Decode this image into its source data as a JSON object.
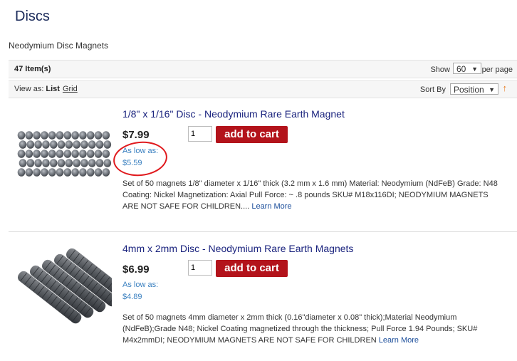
{
  "page": {
    "title": "Discs",
    "subtitle": "Neodymium Disc Magnets"
  },
  "toolbar": {
    "count": "47 Item(s)",
    "show_label": "Show",
    "show_value": "60",
    "per_page_label": "per page",
    "view_as_label": "View as:",
    "view_list": "List",
    "view_grid": "Grid",
    "sort_by_label": "Sort By",
    "sort_value": "Position",
    "sort_dir_icon": "↑"
  },
  "products": [
    {
      "name": "1/8\" x 1/16\" Disc - Neodymium Rare Earth Magnet",
      "price": "$7.99",
      "qty": "1",
      "cart_label": "add to cart",
      "as_low_as_label": "As low as:",
      "as_low_as_price": "$5.59",
      "description": "Set of 50 magnets 1/8\" diameter x 1/16\" thick (3.2 mm x 1.6 mm) Material: Neodymium (NdFeB) Grade: N48 Coating: Nickel Magnetization: Axial Pull Force: ~ .8 pounds SKU# M18x116DI; NEODYMIUM MAGNETS ARE NOT SAFE FOR CHILDREN.... ",
      "learn_more": "Learn More"
    },
    {
      "name": "4mm x 2mm Disc - Neodymium Rare Earth Magnets",
      "price": "$6.99",
      "qty": "1",
      "cart_label": "add to cart",
      "as_low_as_label": "As low as:",
      "as_low_as_price": "$4.89",
      "description": "Set of 50 magnets 4mm diameter x 2mm thick (0.16\"diameter x 0.08\" thick);Material Neodymium (NdFeB);Grade N48; Nickel Coating magnetized through the thickness; Pull Force 1.94 Pounds; SKU# M4x2mmDI; NEODYMIUM MAGNETS ARE NOT SAFE FOR CHILDREN ",
      "learn_more": "Learn More"
    }
  ],
  "colors": {
    "title": "#1a2a5a",
    "product_link": "#1a237e",
    "cart_button": "#b3131b",
    "as_low_as": "#3a80c0",
    "annotation_circle": "#e0191d"
  }
}
